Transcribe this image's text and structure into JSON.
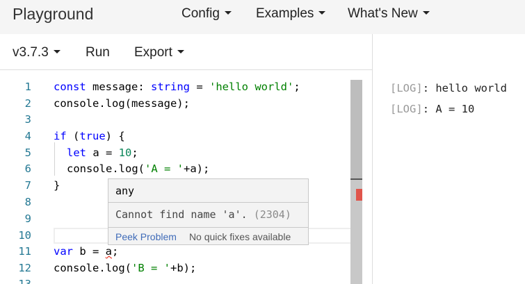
{
  "nav": {
    "brand": "Playground",
    "items": [
      "Config",
      "Examples",
      "What's New"
    ]
  },
  "toolbar": {
    "version": "v3.7.3",
    "run": "Run",
    "export": "Export"
  },
  "editor": {
    "line_numbers": [
      "1",
      "2",
      "3",
      "4",
      "5",
      "6",
      "7",
      "8",
      "9",
      "10",
      "11",
      "12",
      "13"
    ],
    "lines": {
      "l1": {
        "kw1": "const",
        "t1": " message: ",
        "kw2": "string",
        "t2": " = ",
        "s1": "'hello world'",
        "t3": ";"
      },
      "l2": {
        "t1": "console.log(message);"
      },
      "l4": {
        "kw1": "if",
        "t1": " (",
        "kw2": "true",
        "t2": ") {"
      },
      "l5": {
        "kw1": "let",
        "t1": " a = ",
        "n1": "10",
        "t2": ";"
      },
      "l6": {
        "t1": "console.log(",
        "s1": "'A = '",
        "t2": "+a);"
      },
      "l7": {
        "t1": "}"
      },
      "l11": {
        "kw1": "var",
        "t1": " b = ",
        "sq": "a",
        "t2": ";"
      },
      "l12": {
        "t1": "console.log(",
        "s1": "'B = '",
        "t2": "+b);"
      }
    },
    "hover": {
      "type": "any",
      "message": "Cannot find name 'a'.",
      "code": "(2304)",
      "peek": "Peek Problem",
      "no_fix": "No quick fixes available"
    }
  },
  "output": {
    "logs": [
      {
        "tag": "LOG",
        "text": ": hello world"
      },
      {
        "tag": "LOG",
        "text": ": A = 10"
      }
    ]
  }
}
